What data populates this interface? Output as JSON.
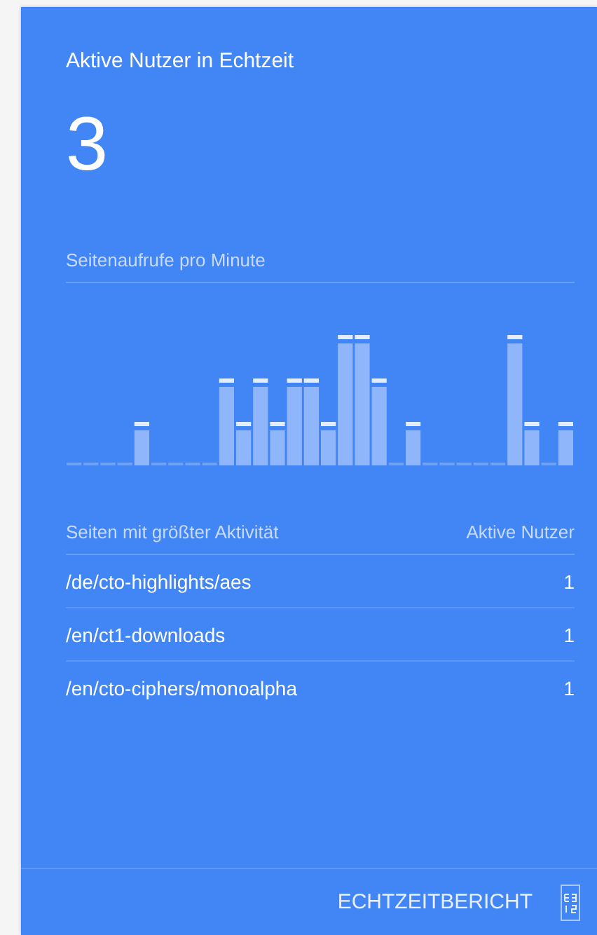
{
  "card": {
    "title": "Aktive Nutzer in Echtzeit",
    "active_users": "3",
    "chart_label": "Seitenaufrufe pro Minute",
    "table": {
      "columns": [
        "Seiten mit größter Aktivität",
        "Aktive Nutzer"
      ],
      "rows": [
        {
          "page": "/de/cto-highlights/aes",
          "users": "1"
        },
        {
          "page": "/en/ct1-downloads",
          "users": "1"
        },
        {
          "page": "/en/cto-ciphers/monoalpha",
          "users": "1"
        }
      ]
    },
    "footer_link": "ECHTZEITBERICHT"
  }
}
